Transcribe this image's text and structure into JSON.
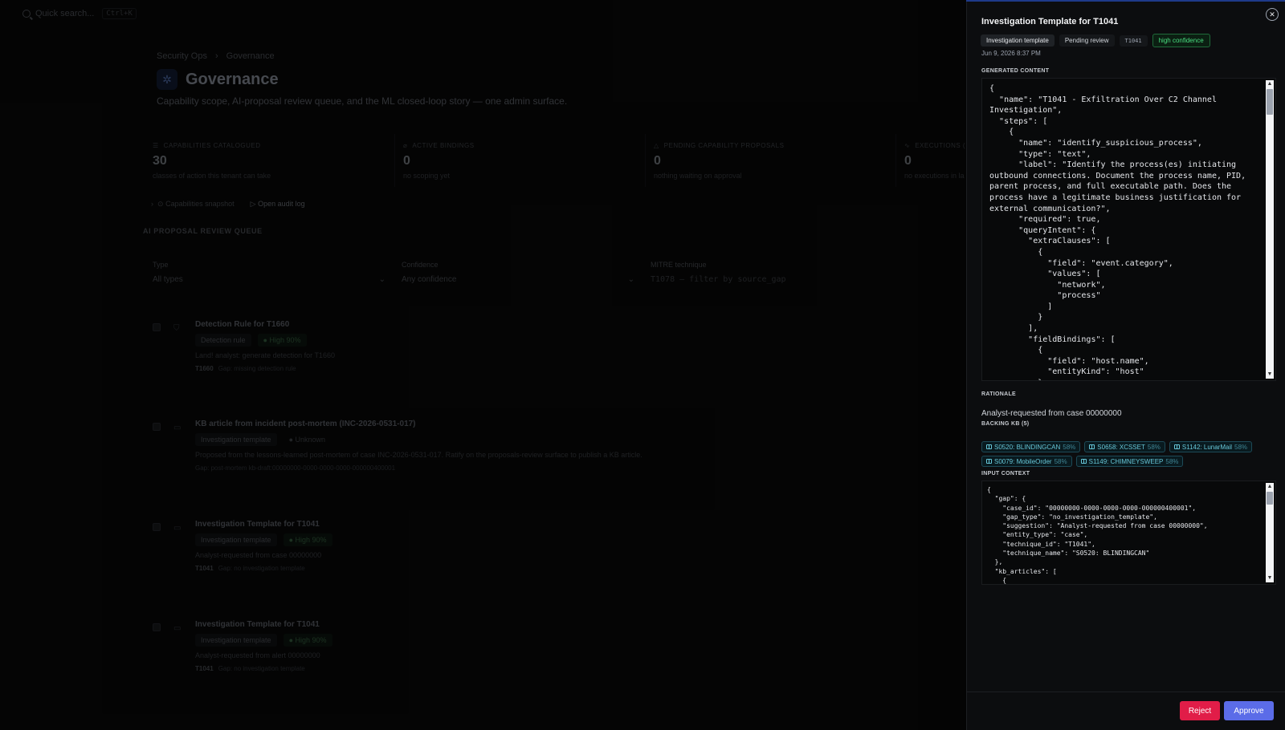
{
  "search": {
    "placeholder": "Quick search...",
    "shortcut": "Ctrl+K"
  },
  "breadcrumb": [
    "Security Ops",
    "Governance"
  ],
  "page": {
    "title": "Governance",
    "subtitle": "Capability scope, AI-proposal review queue, and the ML closed-loop story — one admin surface."
  },
  "stats": [
    {
      "label": "CAPABILITIES CATALOGUED",
      "value": "30",
      "note": "classes of action this tenant can take"
    },
    {
      "label": "ACTIVE BINDINGS",
      "value": "0",
      "note": "no scoping yet"
    },
    {
      "label": "PENDING CAPABILITY PROPOSALS",
      "value": "0",
      "note": "nothing waiting on approval"
    },
    {
      "label": "EXECUTIONS (",
      "value": "0",
      "note": "no executions in la"
    }
  ],
  "links": {
    "snapshot": "Capabilities snapshot",
    "audit": "Open audit log"
  },
  "queue": {
    "heading": "AI PROPOSAL REVIEW QUEUE",
    "filters": {
      "type_label": "Type",
      "type_value": "All types",
      "conf_label": "Confidence",
      "conf_value": "Any confidence",
      "mitre_label": "MITRE technique",
      "mitre_placeholder": "T1078 — filter by source_gap"
    },
    "items": [
      {
        "title": "Detection Rule for T1660",
        "type": "Detection rule",
        "confidence": "High",
        "pct": "90%",
        "desc": "Land! analyst: generate detection for T1660",
        "tech": "T1660",
        "gap": "Gap: missing detection rule"
      },
      {
        "title": "KB article from incident post-mortem (INC-2026-0531-017)",
        "type": "Investigation template",
        "confidence": "Unknown",
        "pct": "",
        "desc": "Proposed from the lessons-learned post-mortem of case INC-2026-0531-017. Ratify on the proposals-review surface to publish a KB article.",
        "tech": "",
        "gap": "Gap: post-mortem kb-draft:00000000-0000-0000-0000-000000400001"
      },
      {
        "title": "Investigation Template for T1041",
        "type": "Investigation template",
        "confidence": "High",
        "pct": "90%",
        "desc": "Analyst-requested from case 00000000",
        "tech": "T1041",
        "gap": "Gap: no investigation template"
      },
      {
        "title": "Investigation Template for T1041",
        "type": "Investigation template",
        "confidence": "High",
        "pct": "90%",
        "desc": "Analyst-requested from alert 00000000",
        "tech": "T1041",
        "gap": "Gap: no investigation template"
      }
    ]
  },
  "drawer": {
    "title": "Investigation Template for T1041",
    "badges": {
      "kind": "Investigation template",
      "status": "Pending review",
      "technique": "T1041",
      "confidence": "high confidence"
    },
    "date": "Jun 9, 2026 8:37 PM",
    "generated_label": "GENERATED CONTENT",
    "generated_content": "{\n  \"name\": \"T1041 - Exfiltration Over C2 Channel Investigation\",\n  \"steps\": [\n    {\n      \"name\": \"identify_suspicious_process\",\n      \"type\": \"text\",\n      \"label\": \"Identify the process(es) initiating outbound connections. Document the process name, PID, parent process, and full executable path. Does the process have a legitimate business justification for external communication?\",\n      \"required\": true,\n      \"queryIntent\": {\n        \"extraClauses\": [\n          {\n            \"field\": \"event.category\",\n            \"values\": [\n              \"network\",\n              \"process\"\n            ]\n          }\n        ],\n        \"fieldBindings\": [\n          {\n            \"field\": \"host.name\",\n            \"entityKind\": \"host\"\n          }",
    "rationale_label": "RATIONALE",
    "rationale": "Analyst-requested from case 00000000",
    "kb_label": "BACKING KB (5)",
    "kb": [
      {
        "name": "S0520: BLINDINGCAN",
        "pct": "58%"
      },
      {
        "name": "S0658: XCSSET",
        "pct": "58%"
      },
      {
        "name": "S1142: LunarMail",
        "pct": "58%"
      },
      {
        "name": "S0079: MobileOrder",
        "pct": "58%"
      },
      {
        "name": "S1149: CHIMNEYSWEEP",
        "pct": "58%"
      }
    ],
    "input_label": "INPUT CONTEXT",
    "input_context": "{\n  \"gap\": {\n    \"case_id\": \"00000000-0000-0000-0000-000000400001\",\n    \"gap_type\": \"no_investigation_template\",\n    \"suggestion\": \"Analyst-requested from case 00000000\",\n    \"entity_type\": \"case\",\n    \"technique_id\": \"T1041\",\n    \"technique_name\": \"S0520: BLINDINGCAN\"\n  },\n  \"kb_articles\": [\n    {",
    "reject_label": "Reject",
    "approve_label": "Approve"
  },
  "colors": {
    "accent": "#5b6ce8",
    "danger": "#e11d48",
    "success": "#4ade80",
    "kb": "#67c7d8"
  }
}
